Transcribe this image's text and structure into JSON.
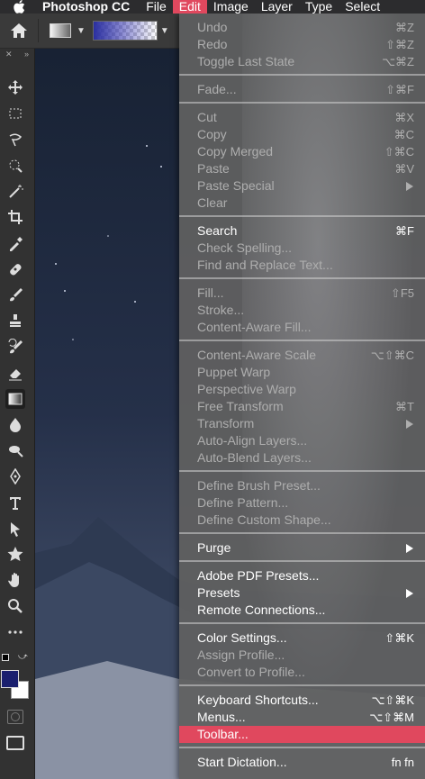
{
  "menubar": {
    "app_name": "Photoshop CC",
    "items": [
      "File",
      "Edit",
      "Image",
      "Layer",
      "Type",
      "Select"
    ]
  },
  "edit_menu": {
    "groups": [
      [
        {
          "label": "Undo",
          "shortcut": "⌘Z",
          "disabled": true
        },
        {
          "label": "Redo",
          "shortcut": "⇧⌘Z",
          "disabled": true
        },
        {
          "label": "Toggle Last State",
          "shortcut": "⌥⌘Z",
          "disabled": true
        }
      ],
      [
        {
          "label": "Fade...",
          "shortcut": "⇧⌘F",
          "disabled": true
        }
      ],
      [
        {
          "label": "Cut",
          "shortcut": "⌘X",
          "disabled": true
        },
        {
          "label": "Copy",
          "shortcut": "⌘C",
          "disabled": true
        },
        {
          "label": "Copy Merged",
          "shortcut": "⇧⌘C",
          "disabled": true
        },
        {
          "label": "Paste",
          "shortcut": "⌘V",
          "disabled": true
        },
        {
          "label": "Paste Special",
          "submenu": true,
          "disabled": true
        },
        {
          "label": "Clear",
          "disabled": true
        }
      ],
      [
        {
          "label": "Search",
          "shortcut": "⌘F",
          "disabled": false
        },
        {
          "label": "Check Spelling...",
          "disabled": true
        },
        {
          "label": "Find and Replace Text...",
          "disabled": true
        }
      ],
      [
        {
          "label": "Fill...",
          "shortcut": "⇧F5",
          "disabled": true
        },
        {
          "label": "Stroke...",
          "disabled": true
        },
        {
          "label": "Content-Aware Fill...",
          "disabled": true
        }
      ],
      [
        {
          "label": "Content-Aware Scale",
          "shortcut": "⌥⇧⌘C",
          "disabled": true
        },
        {
          "label": "Puppet Warp",
          "disabled": true
        },
        {
          "label": "Perspective Warp",
          "disabled": true
        },
        {
          "label": "Free Transform",
          "shortcut": "⌘T",
          "disabled": true
        },
        {
          "label": "Transform",
          "submenu": true,
          "disabled": true
        },
        {
          "label": "Auto-Align Layers...",
          "disabled": true
        },
        {
          "label": "Auto-Blend Layers...",
          "disabled": true
        }
      ],
      [
        {
          "label": "Define Brush Preset...",
          "disabled": true
        },
        {
          "label": "Define Pattern...",
          "disabled": true
        },
        {
          "label": "Define Custom Shape...",
          "disabled": true
        }
      ],
      [
        {
          "label": "Purge",
          "submenu": true,
          "disabled": false
        }
      ],
      [
        {
          "label": "Adobe PDF Presets...",
          "disabled": false
        },
        {
          "label": "Presets",
          "submenu": true,
          "disabled": false
        },
        {
          "label": "Remote Connections...",
          "disabled": false
        }
      ],
      [
        {
          "label": "Color Settings...",
          "shortcut": "⇧⌘K",
          "disabled": false
        },
        {
          "label": "Assign Profile...",
          "disabled": true
        },
        {
          "label": "Convert to Profile...",
          "disabled": true
        }
      ],
      [
        {
          "label": "Keyboard Shortcuts...",
          "shortcut": "⌥⇧⌘K",
          "disabled": false
        },
        {
          "label": "Menus...",
          "shortcut": "⌥⇧⌘M",
          "disabled": false
        },
        {
          "label": "Toolbar...",
          "disabled": false,
          "highlighted": true
        }
      ],
      [
        {
          "label": "Start Dictation...",
          "shortcut": "fn fn",
          "disabled": false
        }
      ]
    ]
  },
  "colors": {
    "accent": "#e0485e",
    "foreground_swatch": "#1a1f6e",
    "background_swatch": "#ffffff"
  },
  "tools": [
    "move-icon",
    "marquee-icon",
    "lasso-icon",
    "quick-select-icon",
    "magic-wand-icon",
    "crop-icon",
    "eyedropper-icon",
    "healing-brush-icon",
    "brush-icon",
    "stamp-icon",
    "history-brush-icon",
    "eraser-icon",
    "gradient-icon",
    "blur-icon",
    "dodge-icon",
    "pen-icon",
    "type-icon",
    "path-select-icon",
    "shape-icon",
    "hand-icon",
    "zoom-icon",
    "more-tools-icon"
  ]
}
